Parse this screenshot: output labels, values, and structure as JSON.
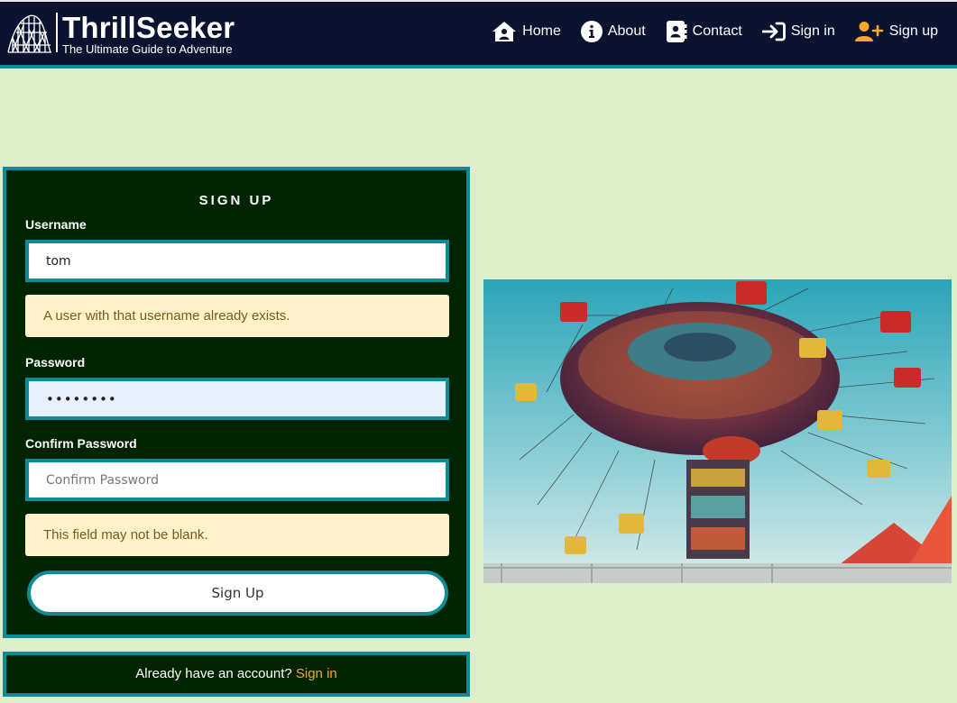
{
  "brand": {
    "title": "ThrillSeeker",
    "subtitle": "The Ultimate Guide to Adventure"
  },
  "nav": {
    "items": [
      {
        "label": "Home",
        "icon": "house-user-icon"
      },
      {
        "label": "About",
        "icon": "info-circle-icon"
      },
      {
        "label": "Contact",
        "icon": "address-book-icon"
      },
      {
        "label": "Sign in",
        "icon": "sign-in-icon"
      },
      {
        "label": "Sign up",
        "icon": "user-plus-icon",
        "accent": "#f7a82a"
      }
    ]
  },
  "form": {
    "heading": "SIGN UP",
    "username": {
      "label": "Username",
      "value": "tom",
      "error": "A user with that username already exists."
    },
    "password": {
      "label": "Password",
      "value": "••••••••"
    },
    "confirm": {
      "label": "Confirm Password",
      "placeholder": "Confirm Password",
      "error": "This field may not be blank."
    },
    "submit_label": "Sign Up"
  },
  "signin_prompt": {
    "text": "Already have an account?",
    "link": "Sign in"
  },
  "colors": {
    "navbar": "#0b1330",
    "accent_border": "#0f8a96",
    "form_bg": "#002400",
    "page_bg": "#dfeeca",
    "link": "#f7a82a",
    "error_bg": "#fdf2c9"
  }
}
